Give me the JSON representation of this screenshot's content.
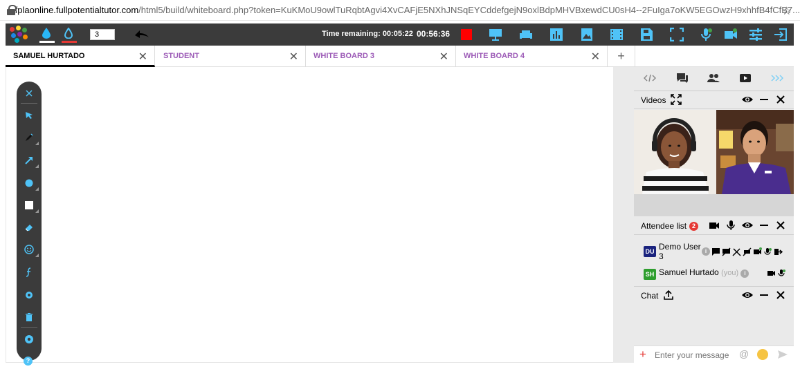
{
  "browser": {
    "url_host": "fplaonline.fullpotentialtutor.com",
    "url_rest": "/html5/build/whiteboard.php?token=KuKMoU9owlTuRqbtAgvi4XvCAFjE5NXhJNSqEYCddefgejN9oxlBdpMHVBxewdCU0sH4--2FuIga7oKW5EGOwzH9xhhfB4fCfB7..."
  },
  "toolbar": {
    "stroke_size": "3",
    "time_remaining_label": "Time remaining: 00:05:22",
    "elapsed": "00:56:36",
    "colors": {
      "drop1": "#29b6f6",
      "drop1_bar": "#ffffff",
      "drop2": "#4fc3f7",
      "drop2_bar": "#e53935",
      "record": "#ff0000"
    },
    "icons": [
      "presentation-icon",
      "sofa-icon",
      "bar-chart-icon",
      "image-icon",
      "film-icon",
      "save-icon",
      "fullscreen-icon",
      "mic-settings-icon",
      "video-settings-icon",
      "sliders-icon",
      "exit-icon"
    ]
  },
  "tabs": [
    {
      "label": "SAMUEL HURTADO",
      "active": true
    },
    {
      "label": "STUDENT",
      "active": false
    },
    {
      "label": "WHITE BOARD 3",
      "active": false
    },
    {
      "label": "WHITE BOARD 4",
      "active": false
    }
  ],
  "left_tools": [
    "close-icon",
    "select-arrow-icon",
    "pen-icon",
    "line-arrow-icon",
    "circle-icon",
    "square-icon",
    "eraser-icon",
    "smiley-icon",
    "formula-icon",
    "settings-small-icon",
    "trash-icon",
    "settings-icon"
  ],
  "right_panel": {
    "tab_icons": [
      "code-icon",
      "chat-icon",
      "people-icon",
      "youtube-icon",
      "more-icon"
    ],
    "videos": {
      "title": "Videos"
    },
    "attendees": {
      "title": "Attendee list",
      "count": "2",
      "items": [
        {
          "initials": "DU",
          "name": "Demo User 3",
          "avatar_color": "#1a237e",
          "you": ""
        },
        {
          "initials": "SH",
          "name": "Samuel Hurtado",
          "avatar_color": "#2e9e2e",
          "you": "(you)"
        }
      ]
    },
    "chat": {
      "title": "Chat",
      "placeholder": "Enter your message"
    }
  }
}
